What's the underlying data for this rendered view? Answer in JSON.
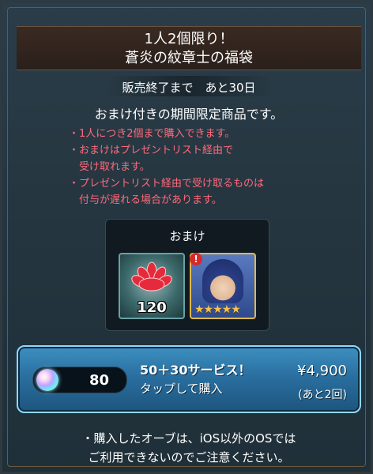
{
  "header": {
    "title_line1": "1人2個限り！",
    "title_line2": "蒼炎の紋章士の福袋"
  },
  "countdown_text": "販売終了まで　あと30日",
  "description": {
    "main": "おまけ付きの期間限定商品です。",
    "notes": [
      "・1人につき2個まで購入できます。",
      "・おまけはプレゼントリスト経由で",
      "　受け取れます。",
      "・プレゼントリスト経由で受け取るものは",
      "　付与が遅れる場合があります。"
    ]
  },
  "bonus": {
    "title": "おまけ",
    "items": [
      {
        "icon": "red-lotus-orb-icon",
        "count": "120"
      },
      {
        "icon": "hero-portrait-icon",
        "badge": "!",
        "stars": "★★★★★"
      }
    ]
  },
  "purchase": {
    "orb_price": "80",
    "title": "50＋30サービス！",
    "subtitle": "タップして購入",
    "price": "¥4,900",
    "remaining": "(あと2回)"
  },
  "footer": {
    "line1": "・購入したオーブは、iOS以外のOSでは",
    "line2": "ご利用できないのでご注意ください。"
  },
  "colors": {
    "accent_blue": "#2a6fa0",
    "note_red": "#ff6a7a",
    "frame_gold": "#6b5a40"
  }
}
